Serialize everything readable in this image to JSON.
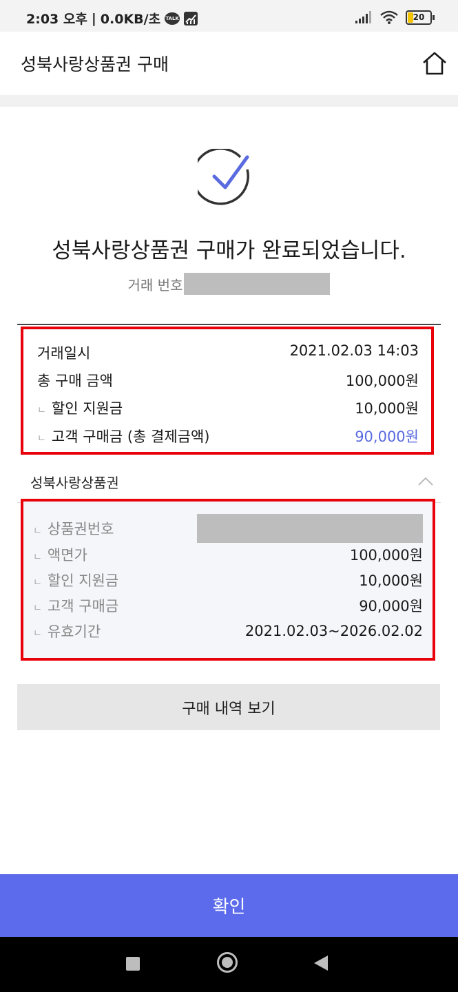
{
  "status_bar": {
    "time": "2:03 오후",
    "speed": "0.0KB/초",
    "talk_badge": "TALK",
    "battery": "20"
  },
  "header": {
    "title": "성북사랑상품권 구매",
    "home_icon": "home-icon"
  },
  "result": {
    "icon": "check-circle-icon",
    "message": "성북사랑상품권 구매가 완료되었습니다.",
    "transaction_label": "거래 번호"
  },
  "summary": {
    "rows": [
      {
        "label": "거래일시",
        "value": "2021.02.03 14:03"
      },
      {
        "label": "총 구매 금액",
        "value": "100,000원"
      },
      {
        "label": "할인 지원금",
        "value": "10,000원"
      },
      {
        "label": "고객 구매금 (총 결제금액)",
        "value": "90,000원"
      }
    ],
    "corner_mark": "ㄴ",
    "accent_color": "#5a6be0"
  },
  "voucher_section": {
    "title": "성북사랑상품권",
    "rows": [
      {
        "label": "상품권번호",
        "value": ""
      },
      {
        "label": "액면가",
        "value": "100,000원"
      },
      {
        "label": "할인 지원금",
        "value": "10,000원"
      },
      {
        "label": "고객 구매금",
        "value": "90,000원"
      },
      {
        "label": "유효기간",
        "value": "2021.02.03~2026.02.02"
      }
    ]
  },
  "buttons": {
    "history": "구매 내역 보기",
    "confirm": "확인",
    "confirm_color": "#5b6bec"
  }
}
